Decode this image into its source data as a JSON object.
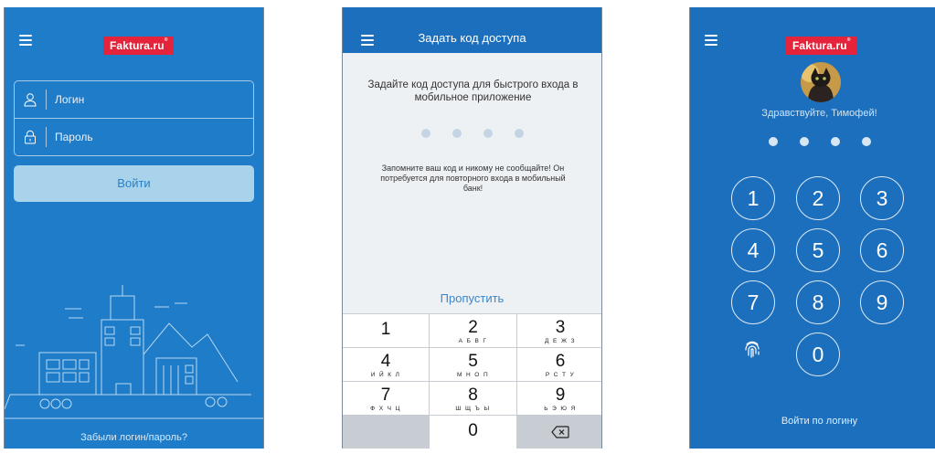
{
  "screen1": {
    "brand": "Faktura.ru",
    "login_placeholder": "Логин",
    "password_placeholder": "Пароль",
    "login_button": "Войти",
    "forgot_link": "Забыли логин/пароль?"
  },
  "screen2": {
    "title": "Задать код доступа",
    "prompt": "Задайте код доступа для быстрого входа в мобильное приложение",
    "note": "Запомните ваш код и никому не сообщайте! Он потребуется для повторного входа в мобильный банк!",
    "skip": "Пропустить",
    "keys": [
      {
        "digit": "1",
        "letters": ""
      },
      {
        "digit": "2",
        "letters": "А Б В Г"
      },
      {
        "digit": "3",
        "letters": "Д Е Ж З"
      },
      {
        "digit": "4",
        "letters": "И Й К Л"
      },
      {
        "digit": "5",
        "letters": "М Н О П"
      },
      {
        "digit": "6",
        "letters": "Р С Т У"
      },
      {
        "digit": "7",
        "letters": "Ф Х Ч Ц"
      },
      {
        "digit": "8",
        "letters": "Ш Щ Ъ Ы"
      },
      {
        "digit": "9",
        "letters": "Ь Э Ю Я"
      },
      {
        "digit": "0",
        "letters": ""
      }
    ]
  },
  "screen3": {
    "brand": "Faktura.ru",
    "greeting": "Здравствуйте, Тимофей!",
    "keys": [
      "1",
      "2",
      "3",
      "4",
      "5",
      "6",
      "7",
      "8",
      "9",
      "0"
    ],
    "login_link": "Войти по логину"
  },
  "colors": {
    "primary_blue": "#1f7cc8",
    "header_blue": "#1c6fbd",
    "brand_red": "#e5243b",
    "button_light": "#a9d3ea"
  },
  "icons": [
    "menu-icon",
    "user-icon",
    "lock-icon",
    "backspace-icon",
    "fingerprint-icon"
  ]
}
